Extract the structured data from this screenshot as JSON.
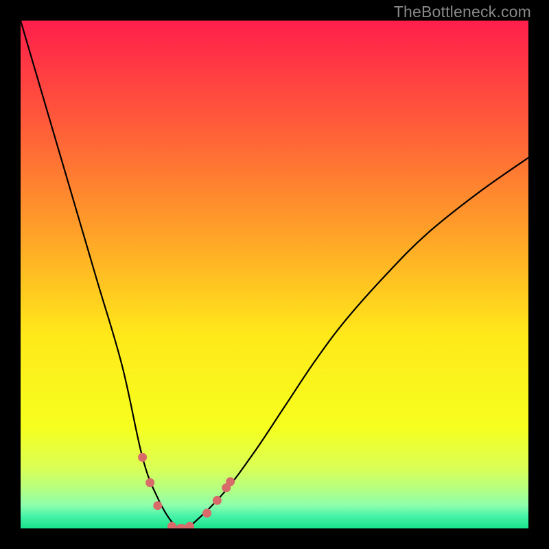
{
  "watermark": "TheBottleneck.com",
  "chart_data": {
    "type": "line",
    "title": "",
    "xlabel": "",
    "ylabel": "",
    "xlim": [
      0,
      100
    ],
    "ylim": [
      0,
      100
    ],
    "grid": false,
    "legend": false,
    "series": [
      {
        "name": "bottleneck-curve",
        "x": [
          0,
          5,
          10,
          15,
          20,
          24,
          27,
          30,
          32,
          34,
          40,
          46,
          52,
          58,
          64,
          72,
          80,
          90,
          100
        ],
        "values": [
          100,
          83,
          66,
          49,
          32,
          14,
          6,
          1,
          0,
          1,
          7,
          15,
          24,
          33,
          41,
          50,
          58,
          66,
          73
        ]
      }
    ],
    "highlight_points": {
      "name": "highlight-dots",
      "color": "#d96a6a",
      "points": [
        {
          "x": 24.0,
          "y": 14.0
        },
        {
          "x": 25.5,
          "y": 9.0
        },
        {
          "x": 27.0,
          "y": 4.5
        },
        {
          "x": 29.8,
          "y": 0.4
        },
        {
          "x": 31.5,
          "y": 0.0
        },
        {
          "x": 33.3,
          "y": 0.4
        },
        {
          "x": 36.7,
          "y": 3.0
        },
        {
          "x": 38.7,
          "y": 5.5
        },
        {
          "x": 40.5,
          "y": 8.0
        },
        {
          "x": 41.3,
          "y": 9.2
        }
      ]
    },
    "gradient_stops": [
      {
        "offset": 0.0,
        "color": "#ff1f4b"
      },
      {
        "offset": 0.2,
        "color": "#ff5a3a"
      },
      {
        "offset": 0.42,
        "color": "#ffa228"
      },
      {
        "offset": 0.62,
        "color": "#ffe91a"
      },
      {
        "offset": 0.8,
        "color": "#f6ff1e"
      },
      {
        "offset": 0.88,
        "color": "#dbff55"
      },
      {
        "offset": 0.92,
        "color": "#b7ff7e"
      },
      {
        "offset": 0.955,
        "color": "#8dffad"
      },
      {
        "offset": 0.975,
        "color": "#49f3a8"
      },
      {
        "offset": 1.0,
        "color": "#19e28c"
      }
    ]
  }
}
